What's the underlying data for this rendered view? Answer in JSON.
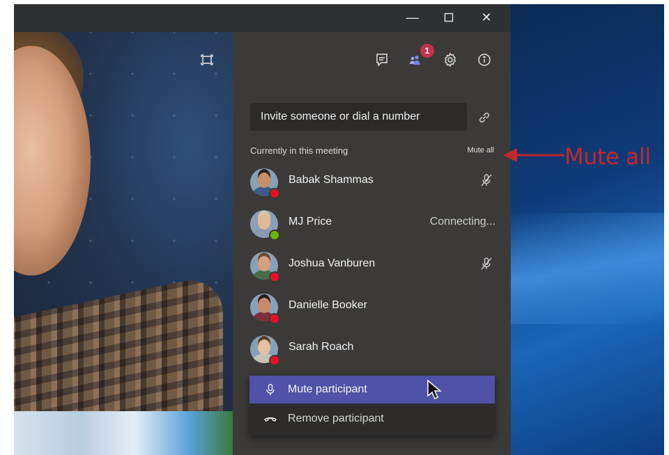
{
  "window": {
    "minimize_glyph": "—",
    "maximize_glyph": "☐",
    "close_glyph": "✕"
  },
  "panel": {
    "toolbar": {
      "chat_icon": "chat-icon",
      "participants_icon": "participants-icon",
      "participants_badge": "1",
      "settings_icon": "gear-icon",
      "info_icon": "info-icon"
    },
    "invite_placeholder": "Invite someone or dial a number",
    "section_title": "Currently in this meeting",
    "mute_all_label": "Mute all",
    "participants": [
      {
        "name": "Babak Shammas",
        "status_color": "#e81123",
        "right": "",
        "muted": true
      },
      {
        "name": "MJ Price",
        "status_color": "#6bb700",
        "right": "Connecting...",
        "muted": false
      },
      {
        "name": "Joshua Vanburen",
        "status_color": "#e81123",
        "right": "",
        "muted": true
      },
      {
        "name": "Danielle Booker",
        "status_color": "#e81123",
        "right": "",
        "muted": false
      },
      {
        "name": "Sarah Roach",
        "status_color": "#e81123",
        "right": "",
        "muted": false
      }
    ],
    "context_menu": {
      "mute_label": "Mute participant",
      "remove_label": "Remove participant"
    }
  },
  "annotation": {
    "text": "Mute all",
    "color": "#c4282d"
  }
}
